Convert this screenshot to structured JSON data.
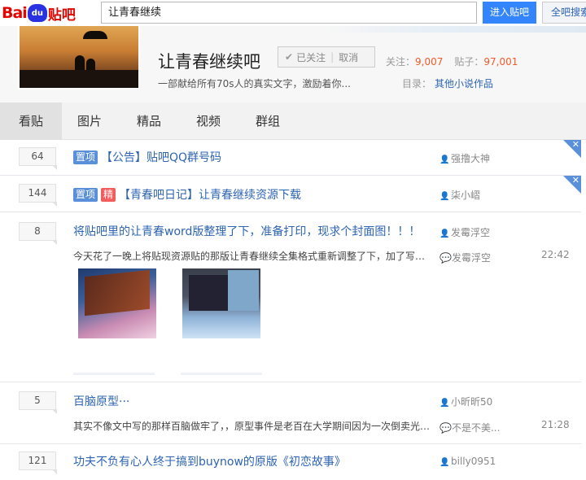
{
  "topbar": {
    "logo": {
      "bai": "Bai",
      "du": "du",
      "tieba": "贴吧"
    },
    "search_value": "让青春继续",
    "enter_button": "进入贴吧",
    "search_all_button": "全吧搜索"
  },
  "forum": {
    "title": "让青春继续吧",
    "follow_label": "已关注",
    "unfollow_label": "取消",
    "follow_count_label": "关注：",
    "follow_count": "9,007",
    "post_count_label": "贴子：",
    "post_count": "97,001",
    "description": "一部献给所有70s人的真实文字，激励着你...",
    "catalog_label": "目录：",
    "catalog_value": "其他小说作品"
  },
  "tabs": [
    "看贴",
    "图片",
    "精品",
    "视频",
    "群组"
  ],
  "threads": [
    {
      "replies": "64",
      "tags": [
        "置项"
      ],
      "title": "【公告】贴吧QQ群号码",
      "author": "强撸大神",
      "pinned": true
    },
    {
      "replies": "144",
      "tags": [
        "置项",
        "精"
      ],
      "title": "【青春吧日记】让青春继续资源下载",
      "author": "柒小嶍",
      "pinned": true
    },
    {
      "replies": "8",
      "title": "将贴吧里的让青春word版整理了下，准备打印，现求个封面图！！！",
      "author": "发霉浮空",
      "abstract": "今天花了一晚上将贴现资源贴的那版让青春继续全集格式重新调整了下，加了写插图...",
      "last_reply_user": "发霉浮空",
      "time": "22:42"
    },
    {
      "replies": "5",
      "title": "百脑原型···",
      "author": "小昕昕50",
      "abstract": "其实不像文中写的那样百脑做牢了，，原型事件是老百在大学期间因为一次倒卖光碟...",
      "last_reply_user": "不是不美...",
      "time": "21:28"
    },
    {
      "replies": "121",
      "title": "功夫不负有心人终于搞到buynow的原版《初恋故事》",
      "author": "billy0951"
    }
  ],
  "colors": {
    "link_blue": "#2d64b3",
    "button_blue": "#3385ff",
    "count_orange": "#f05a28",
    "tag_top": "#5a8fd9",
    "tag_good": "#f35c5c"
  }
}
